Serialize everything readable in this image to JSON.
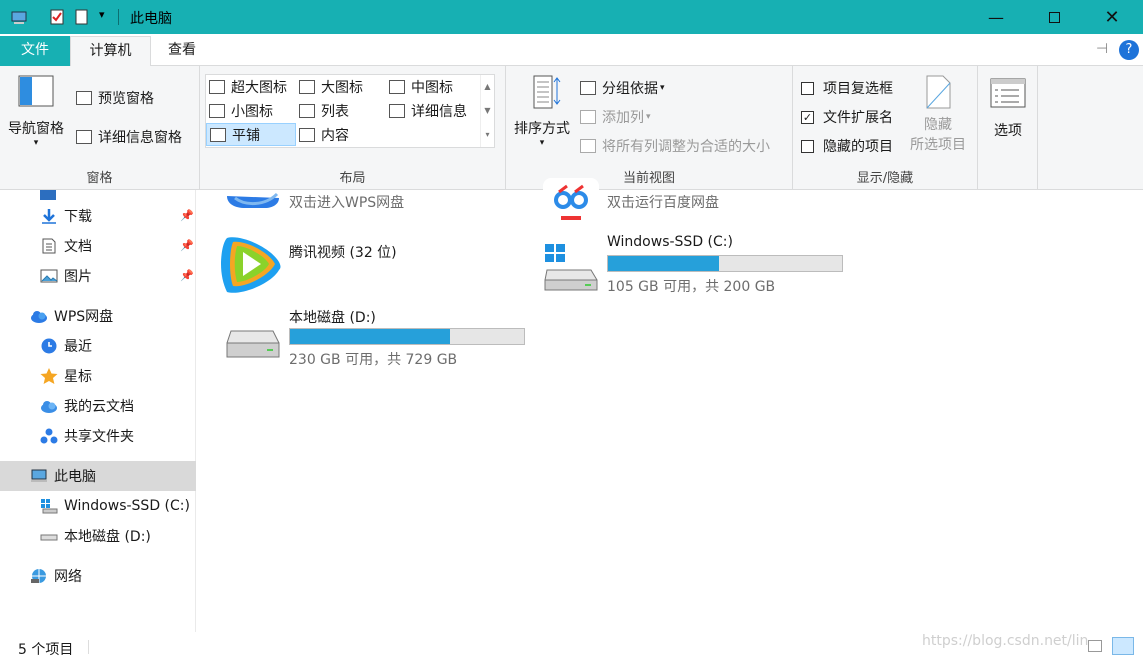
{
  "window": {
    "title": "此电脑"
  },
  "tabs": {
    "file": "文件",
    "computer": "计算机",
    "view": "查看"
  },
  "ribbon": {
    "panes": {
      "label": "窗格",
      "nav_pane": "导航窗格",
      "preview_pane": "预览窗格",
      "details_pane": "详细信息窗格"
    },
    "layout": {
      "label": "布局",
      "items": [
        "超大图标",
        "大图标",
        "中图标",
        "小图标",
        "列表",
        "详细信息",
        "平铺",
        "内容"
      ]
    },
    "current_view": {
      "label": "当前视图",
      "sort_by": "排序方式",
      "group_by": "分组依据",
      "add_column": "添加列",
      "fit_columns": "将所有列调整为合适的大小"
    },
    "show_hide": {
      "label": "显示/隐藏",
      "item_checkboxes": "项目复选框",
      "item_checkboxes_checked": false,
      "file_extensions": "文件扩展名",
      "file_extensions_checked": true,
      "hidden_items": "隐藏的项目",
      "hidden_items_checked": false,
      "hide_selected": "隐藏",
      "hide_selected_line2": "所选项目"
    },
    "options": "选项"
  },
  "nav": {
    "items": [
      {
        "label": "下载",
        "icon": "download-icon",
        "pinned": true
      },
      {
        "label": "文档",
        "icon": "document-icon",
        "pinned": true
      },
      {
        "label": "图片",
        "icon": "picture-icon",
        "pinned": true
      },
      {
        "label": "WPS网盘",
        "icon": "wps-cloud-icon",
        "pinned": false
      },
      {
        "label": "最近",
        "icon": "recent-icon",
        "pinned": false
      },
      {
        "label": "星标",
        "icon": "star-icon",
        "pinned": false
      },
      {
        "label": "我的云文档",
        "icon": "cloud-docs-icon",
        "pinned": false
      },
      {
        "label": "共享文件夹",
        "icon": "shared-folder-icon",
        "pinned": false
      },
      {
        "label": "此电脑",
        "icon": "this-pc-icon",
        "pinned": false,
        "selected": true
      },
      {
        "label": "Windows-SSD (C:)",
        "icon": "drive-c-icon",
        "pinned": false
      },
      {
        "label": "本地磁盘 (D:)",
        "icon": "drive-d-icon",
        "pinned": false
      },
      {
        "label": "网络",
        "icon": "network-icon",
        "pinned": false
      }
    ]
  },
  "content": {
    "wps_drive": {
      "subtitle": "双击进入WPS网盘"
    },
    "baidu_drive": {
      "subtitle": "双击运行百度网盘"
    },
    "tencent_video": {
      "name": "腾讯视频 (32 位)"
    },
    "drive_c": {
      "name": "Windows-SSD (C:)",
      "free": "105 GB 可用，共 200 GB",
      "used_fraction": 0.475
    },
    "drive_d": {
      "name": "本地磁盘 (D:)",
      "free": "230 GB 可用，共 729 GB",
      "used_fraction": 0.684
    }
  },
  "status": {
    "count": "5 个项目",
    "watermark": "https://blog.csdn.net/lin"
  },
  "colors": {
    "accent": "#17b0b3",
    "bar": "#26a0da"
  }
}
